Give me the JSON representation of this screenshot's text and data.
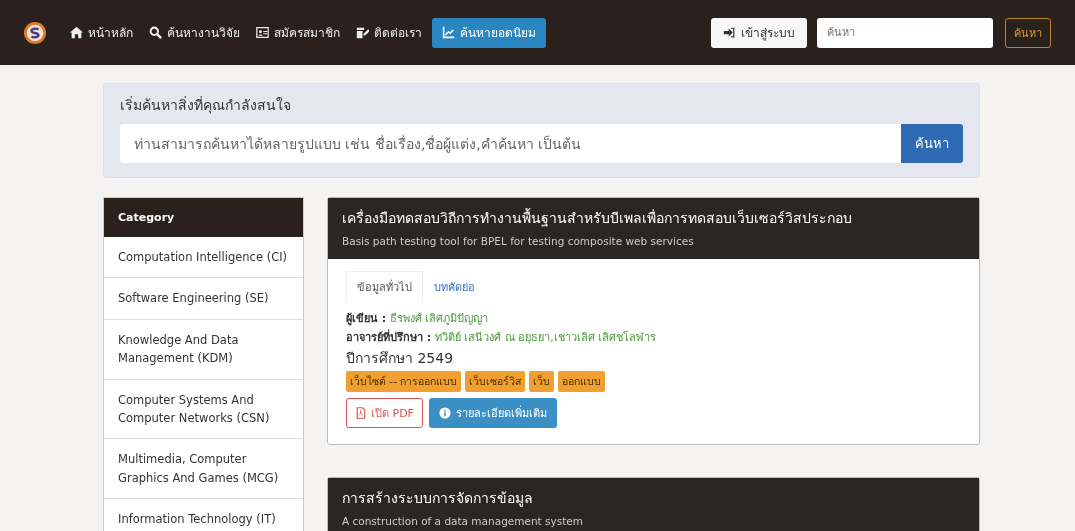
{
  "navbar": {
    "items": [
      {
        "kind": "home",
        "label": "หน้าหลัก",
        "selected": false
      },
      {
        "kind": "search",
        "label": "ค้นหางานวิจัย",
        "selected": false
      },
      {
        "kind": "card",
        "label": "สมัครสมาชิก",
        "selected": false
      },
      {
        "kind": "edit",
        "label": "ติดต่อเรา",
        "selected": false
      },
      {
        "kind": "chart",
        "label": "ค้นหายอดนิยม",
        "selected": true
      }
    ],
    "login_button": "เข้าสู่ระบบ",
    "search": {
      "placeholder": "ค้นหา"
    },
    "search_button": "ค้นหา"
  },
  "hero": {
    "heading": "เริ่มค้นหาสิ่งที่คุณกำลังสนใจ",
    "search": {
      "placeholder": "ท่านสามารถค้นหาได้หลายรูปแบบ เช่น ชื่อเรื่อง,ชื่อผู้แต่ง,คำค้นหา เป็นต้น"
    },
    "search_button": "ค้นหา"
  },
  "sidebar": {
    "header": "Category",
    "items": [
      "Computation Intelligence (CI)",
      "Software Engineering (SE)",
      "Knowledge And Data Management (KDM)",
      "Computer Systems And Computer Networks (CSN)",
      "Multimedia, Computer Graphics And Games (MCG)",
      "Information Technology (IT)"
    ]
  },
  "results": [
    {
      "title": "เครื่องมือทดสอบวิถีการทำงานพื้นฐานสำหรับบีเพลเพื่อการทดสอบเว็บเซอร์วิสประกอบ",
      "subtitle": "Basis path testing tool for BPEL for testing composite web services",
      "tabs": [
        {
          "label": "ข้อมูลทั่วไป",
          "selected": true
        },
        {
          "label": "บทคัดย่อ",
          "selected": false
        }
      ],
      "author_label": "ผู้เขียน :",
      "author": "ธีรพงศ์ เลิศภูมิปัญญา",
      "advisor_label": "อาจารย์ที่ปรึกษา :",
      "advisor": "ทวิติย์ เสนีวงศ์ ณ อยุธยา,เชาวเลิศ เลิศชโลฬาร",
      "year": "ปีการศึกษา 2549",
      "tags": [
        "เว็บไซต์ -- การออกแบบ",
        "เว็บเซอร์วิส",
        "เว็บ",
        "ออกแบบ"
      ],
      "pdf_button": "เปิด PDF",
      "detail_button": "รายละเอียดเพิ่มเติม"
    },
    {
      "title": "การสร้างระบบการจัดการข้อมูล",
      "subtitle": "A construction of a data management system"
    }
  ]
}
